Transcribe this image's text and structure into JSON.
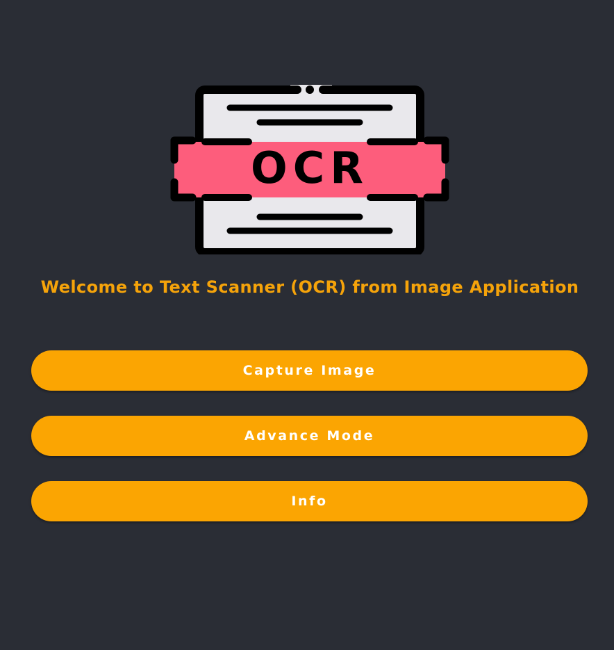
{
  "logo": {
    "text": "OCR",
    "colors": {
      "outline": "#000000",
      "paper": "#e9e8ec",
      "band": "#fd5d7c"
    }
  },
  "welcome": {
    "text": "Welcome to Text Scanner (OCR) from Image Application"
  },
  "buttons": {
    "capture": "Capture Image",
    "advance": "Advance Mode",
    "info": "Info"
  },
  "theme": {
    "background": "#2a2d35",
    "accent": "#fba502",
    "title_color": "#f5a30a",
    "button_text": "#ffffff"
  }
}
